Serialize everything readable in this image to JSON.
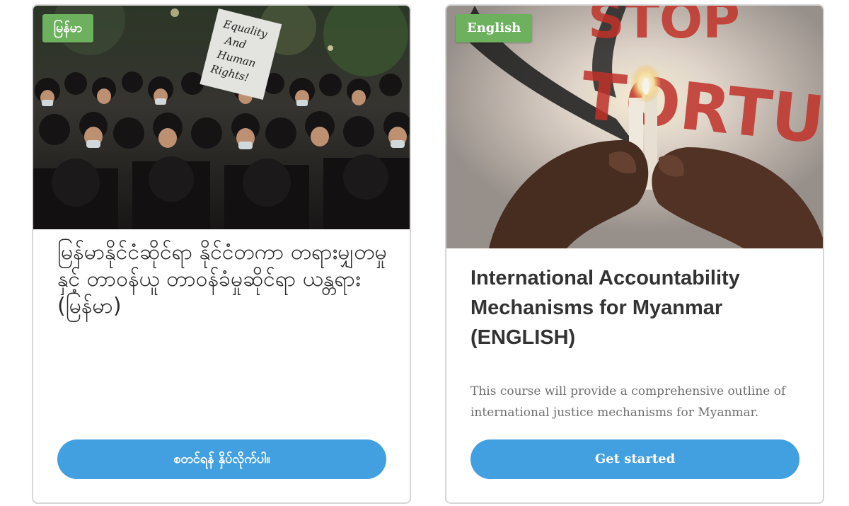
{
  "colors": {
    "badge_bg": "#6db15e",
    "button_bg": "#43a0e0",
    "title_text": "#2b2b2b",
    "desc_text": "#6f6f6f",
    "card_border": "#d6d6d6"
  },
  "cards": [
    {
      "image": "protest-crowd-photo",
      "sign_text": [
        "Equality",
        "And",
        "Human",
        "Rights!"
      ],
      "badge": "မြန်မာ",
      "title": "မြန်မာနိုင်ငံဆိုင်ရာ နိုင်ငံတကာ တရားမျှတမှုနှင့် တာဝန်ယူ တာဝန်ခံမှုဆိုင်ရာ ယန္တရား (မြန်မာ)",
      "description": "",
      "button": "စတင်ရန် နှိပ်လိုက်ပါ။"
    },
    {
      "image": "candle-stop-torture-photo",
      "shirt_text": [
        "STOP",
        "TORTURE"
      ],
      "badge": "English",
      "title": "International Accountability Mechanisms for Myanmar (ENGLISH)",
      "description": "This course will provide a comprehensive outline of international justice mechanisms for Myanmar.",
      "button": "Get started"
    }
  ]
}
